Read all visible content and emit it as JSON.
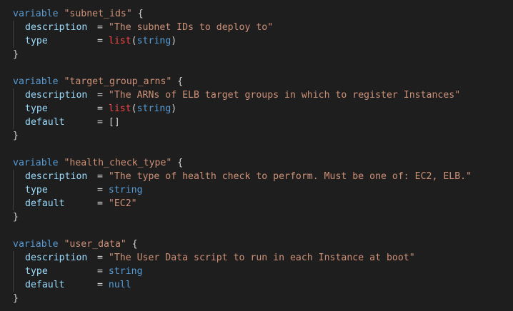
{
  "editor": {
    "blocks": [
      {
        "keyword": "variable",
        "name": "\"subnet_ids\"",
        "open": "{",
        "close": "}",
        "description_key": "description",
        "description_value": "\"The subnet IDs to deploy to\"",
        "type_key": "type",
        "type_fn": "list",
        "type_arg": "string",
        "type_plain": "",
        "default_key": "",
        "default_value": ""
      },
      {
        "keyword": "variable",
        "name": "\"target_group_arns\"",
        "open": "{",
        "close": "}",
        "description_key": "description",
        "description_value": "\"The ARNs of ELB target groups in which to register Instances\"",
        "type_key": "type",
        "type_fn": "list",
        "type_arg": "string",
        "type_plain": "",
        "default_key": "default",
        "default_value": "[]"
      },
      {
        "keyword": "variable",
        "name": "\"health_check_type\"",
        "open": "{",
        "close": "}",
        "description_key": "description",
        "description_value": "\"The type of health check to perform. Must be one of: EC2, ELB.\"",
        "type_key": "type",
        "type_fn": "",
        "type_arg": "",
        "type_plain": "string",
        "default_key": "default",
        "default_value": "\"EC2\""
      },
      {
        "keyword": "variable",
        "name": "\"user_data\"",
        "open": "{",
        "close": "}",
        "description_key": "description",
        "description_value": "\"The User Data script to run in each Instance at boot\"",
        "type_key": "type",
        "type_fn": "",
        "type_arg": "",
        "type_plain": "string",
        "default_key": "default",
        "default_value": "null"
      }
    ],
    "equals": "="
  },
  "colors": {
    "background": "#1e1e1e",
    "keyword": "#569cd6",
    "string": "#ce9178",
    "property": "#9cdcfe",
    "function": "#f44747",
    "punctuation": "#d4d4d4"
  }
}
